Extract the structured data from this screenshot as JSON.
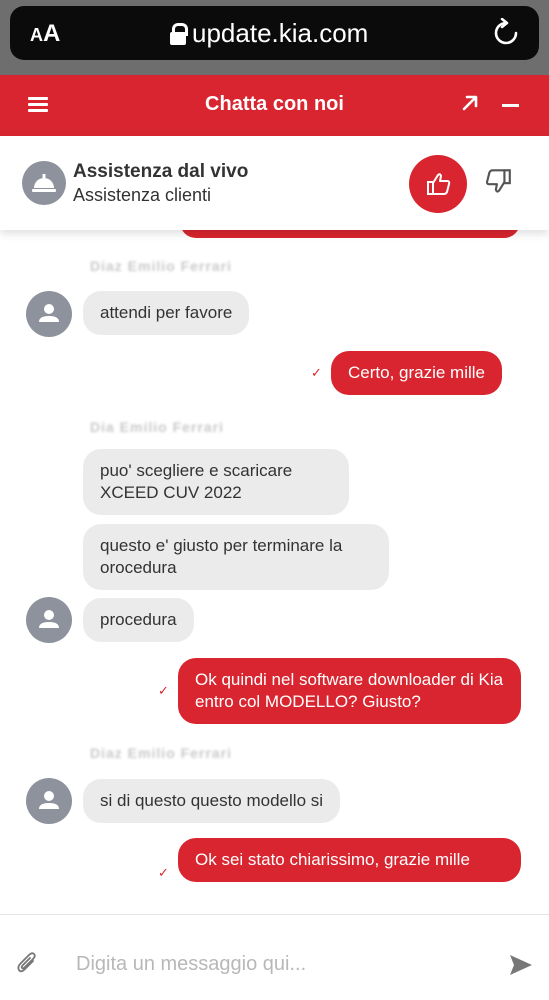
{
  "browser": {
    "aa_small": "A",
    "aa_big": "A",
    "url": "update.kia.com",
    "icons": [
      "lock-icon",
      "reload-icon"
    ]
  },
  "header": {
    "title": "Chatta con noi",
    "icons": [
      "menu-icon",
      "expand-icon",
      "minimize-icon"
    ]
  },
  "agent": {
    "name": "Assistenza dal vivo",
    "role": "Assistenza clienti",
    "icons": [
      "bell-icon",
      "thumbs-up-icon",
      "thumbs-down-icon"
    ]
  },
  "colors": {
    "brand_red": "#d9252f",
    "agent_bubble": "#ebebeb",
    "avatar_gray": "#8d929c"
  },
  "messages": [
    {
      "from": "agent",
      "label": "Diaz Emilio Ferrari",
      "text": "attendi per favore"
    },
    {
      "from": "user",
      "text": "Certo, grazie mille"
    },
    {
      "from": "agent",
      "label": "Dia Emilio Ferrari",
      "text": "puo' scegliere e  scaricare XCEED CUV 2022"
    },
    {
      "from": "agent",
      "text": "questo e' giusto per terminare la orocedura"
    },
    {
      "from": "agent",
      "text": "procedura"
    },
    {
      "from": "user",
      "text": "Ok quindi nel software downloader di Kia entro col MODELLO? Giusto?"
    },
    {
      "from": "agent",
      "label": "Diaz Emilio Ferrari",
      "text": "si di questo questo modello si"
    },
    {
      "from": "user",
      "text": "Ok sei stato chiarissimo, grazie mille"
    }
  ],
  "input": {
    "placeholder": "Digita un messaggio qui...",
    "icons": [
      "paperclip-icon",
      "send-icon"
    ]
  }
}
